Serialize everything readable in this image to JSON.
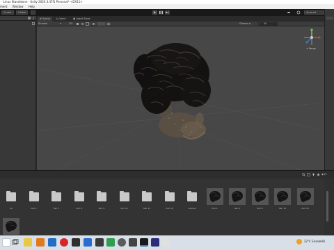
{
  "window": {
    "title": "- Linux Standalone - Unity 2020.3.47f1 Personal* <DX11>"
  },
  "menu": [
    "ment",
    "Window",
    "Help"
  ],
  "toolbar": {
    "center_label": "Center",
    "global_label": "Global",
    "account_label": "Account"
  },
  "scene": {
    "tabs": [
      "Scene",
      "Game",
      "Asset Store"
    ],
    "shading_mode": "Shaded",
    "mode_2d": "2D",
    "gizmos_label": "Gizmos",
    "persp_label": "< Persp",
    "search_label": "All"
  },
  "project": {
    "assets": [
      {
        "label": "ial",
        "kind": "folder"
      },
      {
        "label": "hair 1",
        "kind": "folder"
      },
      {
        "label": "hair 2",
        "kind": "folder"
      },
      {
        "label": "hair 8",
        "kind": "folder"
      },
      {
        "label": "hair 9",
        "kind": "folder"
      },
      {
        "label": "hair 11",
        "kind": "folder"
      },
      {
        "label": "hair 13",
        "kind": "folder"
      },
      {
        "label": "hair 16",
        "kind": "folder"
      },
      {
        "label": "Scenes",
        "kind": "folder"
      },
      {
        "label": "hair 1",
        "kind": "mesh"
      },
      {
        "label": "hair 2",
        "kind": "mesh"
      },
      {
        "label": "hair 8",
        "kind": "mesh"
      },
      {
        "label": "hair 11",
        "kind": "mesh"
      },
      {
        "label": "hair 13",
        "kind": "mesh"
      },
      {
        "label": "",
        "kind": "mesh"
      }
    ],
    "count_label": "15"
  },
  "taskbar": {
    "temperature": "22°C",
    "weather": "Ensoleillé"
  },
  "colors": {
    "accent": "#3a79bb",
    "hair": "#141210",
    "beard": "#6b5d4c",
    "background": "#474747"
  }
}
